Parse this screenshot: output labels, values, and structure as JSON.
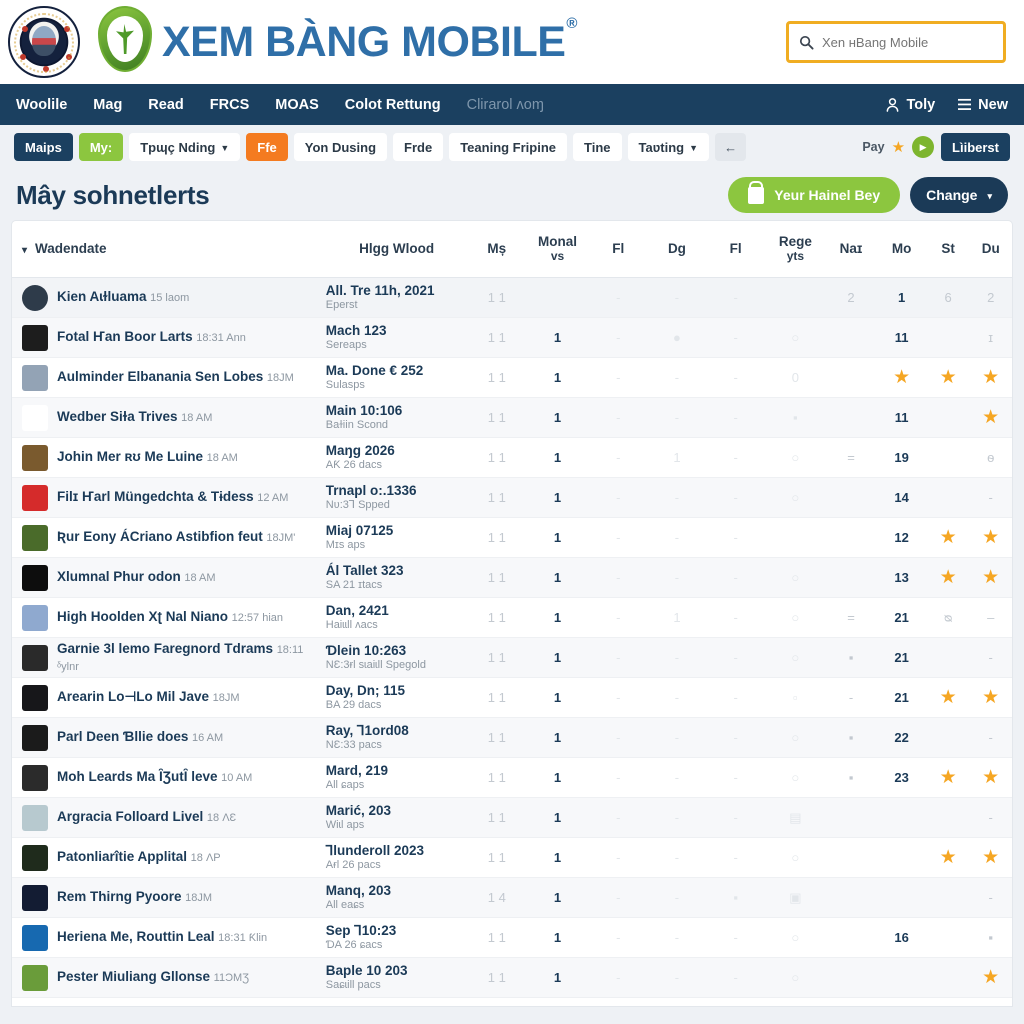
{
  "header": {
    "brand": "XEM BÀNG MOBILE",
    "brand_registered": "®",
    "crest_name": "team-crest-logo",
    "search": {
      "placeholder": "Xen ʜBang Mobile",
      "value": "",
      "icon": "search-icon"
    }
  },
  "nav": {
    "items": [
      {
        "label": "Woolile",
        "muted": false
      },
      {
        "label": "Mag",
        "muted": false
      },
      {
        "label": "Read",
        "muted": false
      },
      {
        "label": "FRCS",
        "muted": false
      },
      {
        "label": "MOAS",
        "muted": false
      },
      {
        "label": "Colot Rettung",
        "muted": false
      },
      {
        "label": "Clirarol ʌoɱ",
        "muted": true
      }
    ],
    "right": [
      {
        "label": "Toly",
        "icon": "user-icon"
      },
      {
        "label": "New",
        "icon": "menu-icon"
      }
    ]
  },
  "toolbar": {
    "buttons": [
      {
        "label": "Maips",
        "style": "navy",
        "caret": false
      },
      {
        "label": "My:",
        "style": "green",
        "caret": false
      },
      {
        "label": "Tpɰç Nding",
        "style": "white",
        "caret": true
      },
      {
        "label": "Ffe",
        "style": "orange",
        "caret": false
      },
      {
        "label": "Yon Dusing",
        "style": "white",
        "caret": false
      },
      {
        "label": "Frde",
        "style": "white",
        "caret": false
      },
      {
        "label": "Teaning Fripine",
        "style": "white",
        "caret": false
      },
      {
        "label": "Tine",
        "style": "white",
        "caret": false
      },
      {
        "label": "Taʋting",
        "style": "white",
        "caret": true
      },
      {
        "label": "←",
        "style": "ghost",
        "caret": false
      }
    ],
    "pay_label": "Pay",
    "star_icon": "star-icon",
    "play_icon": "play-circle-icon",
    "right_button": "Lìiberst"
  },
  "page": {
    "title": "Mây sohnetlerts",
    "primary_button": "Yeur Hainel Bey",
    "primary_button_icon": "lock-icon",
    "secondary_button": "Change",
    "secondary_caret": "▾"
  },
  "table": {
    "sort_caret": "▾",
    "columns": [
      "Wadendate",
      "Hlgg Wlood",
      "Mș",
      "Monal",
      "Fl",
      "Dg",
      "Fl",
      "Rege",
      "Naɪ",
      "Mo",
      "St",
      "Du"
    ],
    "column_subs": {
      "Monal": "vs",
      "Rege": "yts"
    },
    "rows": [
      {
        "name": "Kien Aɩɫluama",
        "sub": "15 laom",
        "event": "All. Tre 11h, 2021",
        "event_sub": "Eperst",
        "c1": "1 1",
        "c2": "",
        "c3": "-",
        "c4": "-",
        "c5": "-",
        "c6": "",
        "c7": "2",
        "mo": "1",
        "st": "6",
        "du": "2",
        "avatar": "#2e3b4a",
        "round": true,
        "st_star": false,
        "du_star": false,
        "mo_star": false
      },
      {
        "name": "Fotal Ҥan Boor Larts",
        "sub": "18:31 Ann",
        "event": "Mach 123",
        "event_sub": "Sereaps",
        "c1": "1 1",
        "c2": "1",
        "c3": "-",
        "c4": "●",
        "c5": "-",
        "c6": "○",
        "c7": "",
        "mo": "11",
        "st": "",
        "du": "ɪ",
        "avatar": "#1d1d1d",
        "round": false,
        "st_star": false,
        "du_star": false,
        "mo_star": false
      },
      {
        "name": "Aulminder Elbanania Sen Lobes",
        "sub": "18ЈM",
        "event": "Ma. Done € 252",
        "event_sub": "Sulasps",
        "c1": "1 1",
        "c2": "1",
        "c3": "-",
        "c4": "-",
        "c5": "-",
        "c6": "0",
        "c7": "",
        "mo": "★",
        "st": "★",
        "du": "★",
        "avatar": "#93a3b5",
        "round": false,
        "st_star": true,
        "du_star": true,
        "mo_star": true
      },
      {
        "name": "Wedber Siɫa Trives",
        "sub": "18 AM",
        "event": "Main 10:106",
        "event_sub": "Baɫiin Scond",
        "c1": "1 1",
        "c2": "1",
        "c3": "-",
        "c4": "-",
        "c5": "-",
        "c6": "▪",
        "c7": "",
        "mo": "11",
        "st": "",
        "du": "★",
        "avatar": "#ffffff",
        "round": false,
        "st_star": false,
        "du_star": true,
        "mo_star": false
      },
      {
        "name": "Johin Mer ʀʊ Me Luine",
        "sub": "18 AM",
        "event": "Maŋg 2026",
        "event_sub": "AƘ 26 dacs",
        "c1": "1 1",
        "c2": "1",
        "c3": "-",
        "c4": "1",
        "c5": "-",
        "c6": "○",
        "c7": "=",
        "mo": "19",
        "st": "",
        "du": "ѳ",
        "avatar": "#7a5a2e",
        "round": false,
        "st_star": false,
        "du_star": false,
        "mo_star": false
      },
      {
        "name": "Filɪ Ҥarl Müngedchta & Tɨdess",
        "sub": "12 AM",
        "event": "Trnapl o:.1336",
        "event_sub": "Nʋ:3Ꞁ Spped",
        "c1": "1 1",
        "c2": "1",
        "c3": "-",
        "c4": "-",
        "c5": "-",
        "c6": "○",
        "c7": "",
        "mo": "14",
        "st": "",
        "du": "-",
        "avatar": "#d52b2b",
        "round": false,
        "st_star": false,
        "du_star": false,
        "mo_star": false
      },
      {
        "name": "Ʀur Eony ÁCriano Astibfion feut",
        "sub": "18ЈM'",
        "event": "Miaj 07125",
        "event_sub": "Mɪs aps",
        "c1": "1 1",
        "c2": "1",
        "c3": "-",
        "c4": "-",
        "c5": "-",
        "c6": "",
        "c7": "",
        "mo": "12",
        "st": "★",
        "du": "★",
        "avatar": "#4a6b2a",
        "round": false,
        "st_star": true,
        "du_star": true,
        "mo_star": false
      },
      {
        "name": "Xlumnal Phur odon",
        "sub": "18 AM",
        "event": "Ál Tallet 323",
        "event_sub": "SA 21 ɪtacs",
        "c1": "1 1",
        "c2": "1",
        "c3": "-",
        "c4": "-",
        "c5": "-",
        "c6": "○",
        "c7": "",
        "mo": "13",
        "st": "★",
        "du": "★",
        "avatar": "#0d0d0d",
        "round": false,
        "st_star": true,
        "du_star": true,
        "mo_star": false
      },
      {
        "name": "High Hoolden Xʈ Nal Niano",
        "sub": "12:57 hian",
        "event": "Dan, 2421",
        "event_sub": "Haiɩɩll ʌacs",
        "c1": "1 1",
        "c2": "1",
        "c3": "-",
        "c4": "1",
        "c5": "-",
        "c6": "○",
        "c7": "=",
        "mo": "21",
        "st": "ᴓ",
        "du": "–",
        "avatar": "#8fa9cf",
        "round": false,
        "st_star": false,
        "du_star": false,
        "mo_star": false
      },
      {
        "name": "Garnie 3l lemo Faregnord Tdrams",
        "sub": "18:11 ᵟylnr",
        "event": "Ɗlein 10:263",
        "event_sub": "NƐ:3ɍl sɩaiɩll Spegold",
        "c1": "1 1",
        "c2": "1",
        "c3": "-",
        "c4": "-",
        "c5": "-",
        "c6": "○",
        "c7": "▪",
        "mo": "21",
        "st": "",
        "du": "-",
        "avatar": "#2a2a2a",
        "round": false,
        "st_star": false,
        "du_star": false,
        "mo_star": false
      },
      {
        "name": "Arearin Lo⊣Lo Mil Jave",
        "sub": "18ЈM",
        "event": "Day, Dn; 115",
        "event_sub": "BA 29 dacs",
        "c1": "1 1",
        "c2": "1",
        "c3": "-",
        "c4": "-",
        "c5": "-",
        "c6": "▫",
        "c7": "-",
        "mo": "21",
        "st": "★",
        "du": "★",
        "avatar": "#17171a",
        "round": false,
        "st_star": true,
        "du_star": true,
        "mo_star": false
      },
      {
        "name": "Parl Deen Ɓllie does",
        "sub": "16 AM",
        "event": "Ray, Ꞁ1ord08",
        "event_sub": "NƐ:33 pacs",
        "c1": "1 1",
        "c2": "1",
        "c3": "-",
        "c4": "-",
        "c5": "-",
        "c6": "○",
        "c7": "▪",
        "mo": "22",
        "st": "",
        "du": "-",
        "avatar": "#1b1b1b",
        "round": false,
        "st_star": false,
        "du_star": false,
        "mo_star": false
      },
      {
        "name": "Moh Leards Ma ȊƷutȊ leve",
        "sub": "10 AM",
        "event": "Mard, 219",
        "event_sub": "All ɕaps",
        "c1": "1 1",
        "c2": "1",
        "c3": "-",
        "c4": "-",
        "c5": "-",
        "c6": "○",
        "c7": "▪",
        "mo": "23",
        "st": "★",
        "du": "★",
        "avatar": "#2b2b2b",
        "round": false,
        "st_star": true,
        "du_star": true,
        "mo_star": false
      },
      {
        "name": "Argracia Folloard Livel",
        "sub": "18 ΛƐ",
        "event": "Marić, 203",
        "event_sub": "Wiɩl aps",
        "c1": "1 1",
        "c2": "1",
        "c3": "-",
        "c4": "-",
        "c5": "-",
        "c6": "▤",
        "c7": "",
        "mo": "",
        "st": "",
        "du": "-",
        "avatar": "#b7c9cf",
        "round": false,
        "st_star": false,
        "du_star": false,
        "mo_star": false
      },
      {
        "name": "Patonliarîtie Applital",
        "sub": "18 ΛP",
        "event": "Ꞁlunderoll 2023",
        "event_sub": "Aɍl 26 pacs",
        "c1": "1 1",
        "c2": "1",
        "c3": "-",
        "c4": "-",
        "c5": "-",
        "c6": "○",
        "c7": "",
        "mo": "",
        "st": "★",
        "du": "★",
        "avatar": "#1f2b1c",
        "round": false,
        "st_star": true,
        "du_star": true,
        "mo_star": false
      },
      {
        "name": "Rem Thirng Pyoore",
        "sub": "18ЈM",
        "event": "Manq, 203",
        "event_sub": "All eaɕs",
        "c1": "1 4",
        "c2": "1",
        "c3": "-",
        "c4": "-",
        "c5": "▪",
        "c6": "▣",
        "c7": "",
        "mo": "",
        "st": "",
        "du": "-",
        "avatar": "#131c33",
        "round": false,
        "st_star": false,
        "du_star": false,
        "mo_star": false
      },
      {
        "name": "Heriena Me, Routtin Leal",
        "sub": "18:31 Ƙlin",
        "event": "Sep Ꞁ10:23",
        "event_sub": "ƊA 26 ɕacs",
        "c1": "1 1",
        "c2": "1",
        "c3": "-",
        "c4": "-",
        "c5": "-",
        "c6": "○",
        "c7": "",
        "mo": "16",
        "st": "",
        "du": "▪",
        "avatar": "#1769b0",
        "round": false,
        "st_star": false,
        "du_star": false,
        "mo_star": false
      },
      {
        "name": "Pester Miuliang Gllonse",
        "sub": "11ƆMƷ",
        "event": "Baple 10 203",
        "event_sub": "Saɕɩill pacs",
        "c1": "1 1",
        "c2": "1",
        "c3": "-",
        "c4": "-",
        "c5": "-",
        "c6": "○",
        "c7": "",
        "mo": "",
        "st": "",
        "du": "★",
        "avatar": "#6a9c3a",
        "round": false,
        "st_star": false,
        "du_star": true,
        "mo_star": false
      }
    ]
  },
  "colors": {
    "nav_bg": "#1b4060",
    "brand_blue": "#2f6fa8",
    "accent_green": "#8cc63f",
    "accent_orange": "#f47b20",
    "accent_yellow": "#f0ad22",
    "star": "#f5a623",
    "page_bg": "#eef1f5"
  }
}
